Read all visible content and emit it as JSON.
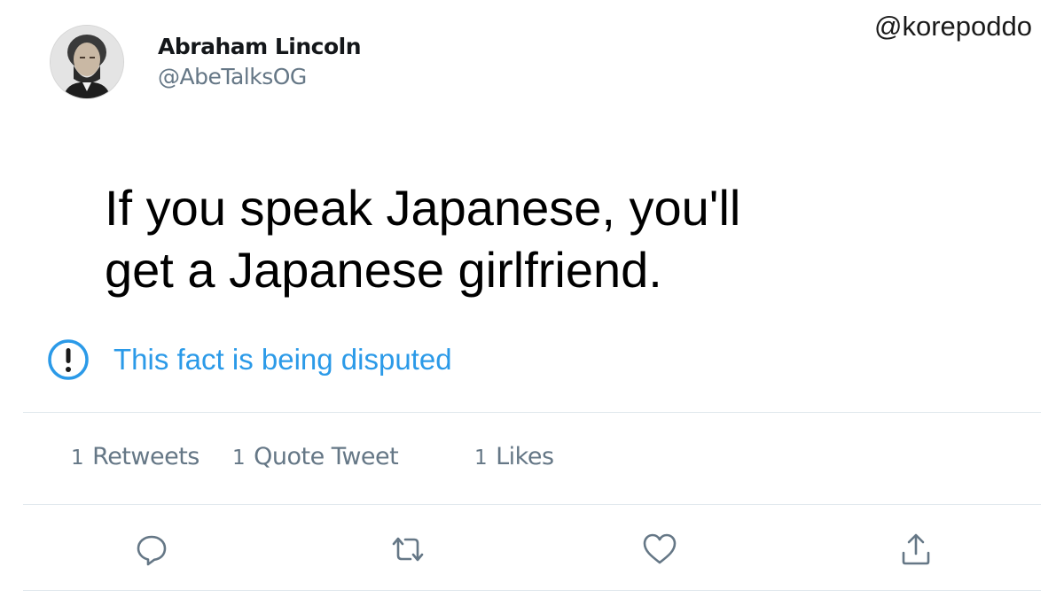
{
  "watermark": "@korepoddo",
  "user": {
    "display_name": "Abraham Lincoln",
    "handle": "@AbeTalksOG",
    "avatar_icon": "portrait-avatar"
  },
  "tweet": {
    "line1": "If you speak Japanese, you'll",
    "line2": "get a Japanese girlfriend."
  },
  "dispute": {
    "label": "This fact is being disputed",
    "icon": "exclamation-circle-icon",
    "color": "#2b9ae8"
  },
  "stats": {
    "retweets_count": "1",
    "retweets_label": "Retweets",
    "quotes_count": "1",
    "quotes_label": "Quote Tweet",
    "likes_count": "1",
    "likes_label": "Likes"
  },
  "actions": {
    "reply_icon": "reply-icon",
    "retweet_icon": "retweet-icon",
    "like_icon": "heart-icon",
    "share_icon": "share-icon",
    "icon_color": "#657786"
  }
}
